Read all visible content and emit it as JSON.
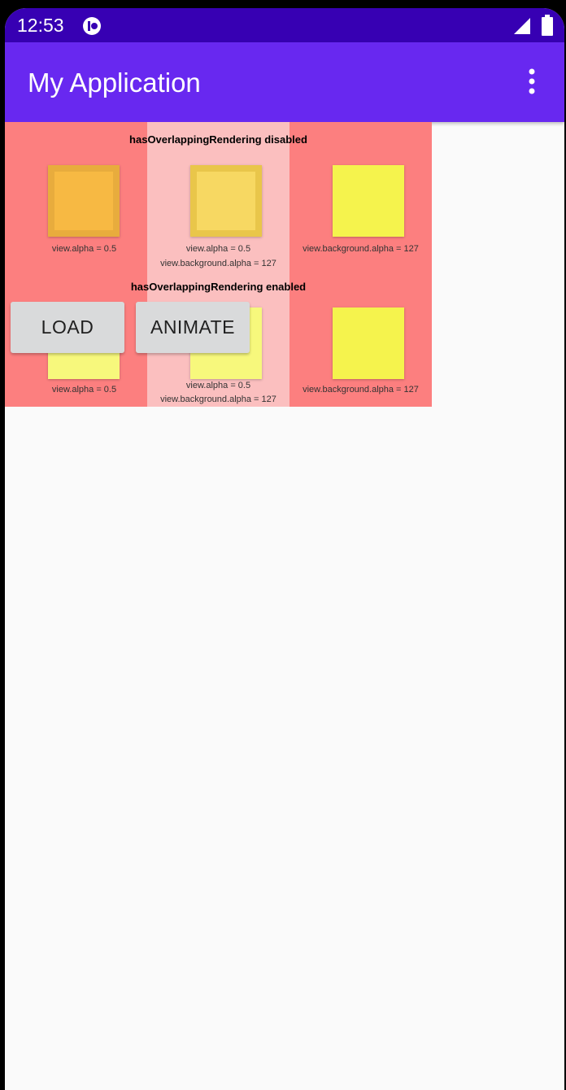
{
  "status_bar": {
    "time": "12:53"
  },
  "app_bar": {
    "title": "My Application"
  },
  "demo": {
    "disabled_heading": "hasOverlappingRendering disabled",
    "enabled_heading": "hasOverlappingRendering enabled",
    "captions": {
      "alpha": "view.alpha = 0.5",
      "alpha_line1": "view.alpha = 0.5",
      "alpha_line2": "view.background.alpha = 127",
      "bg_alpha": "view.background.alpha = 127"
    },
    "colors": {
      "panel": "#fc7f7f",
      "middle_column": "#fbbfbf",
      "swatch_orange": "#f7b943",
      "swatch_orange_border": "#e8ac3d",
      "swatch_gold": "#f7d862",
      "swatch_gold_border": "#e9c64a",
      "swatch_yellow": "#f5f34d",
      "swatch_pale_yellow": "#f7f87c"
    }
  },
  "buttons": {
    "load": "LOAD",
    "animate": "ANIMATE"
  }
}
